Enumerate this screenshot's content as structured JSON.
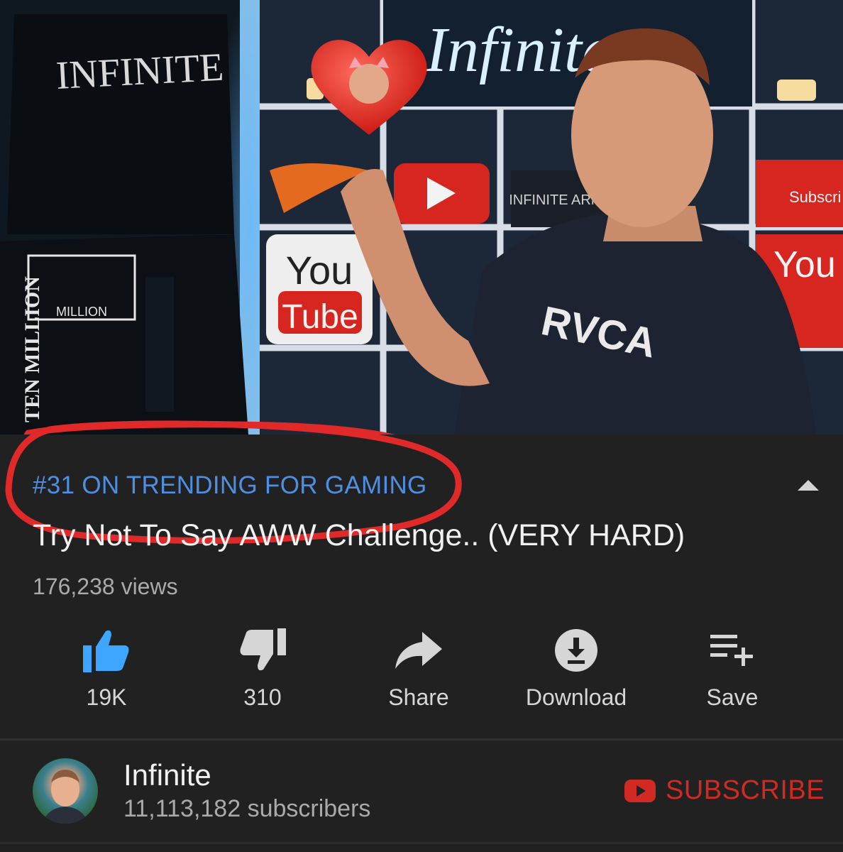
{
  "video": {
    "overlay_texts": {
      "neon_sign": "Infinite",
      "hoodie_print": "INFINITE",
      "jersey_text": "TEN MILLION",
      "jersey_badge": "MILLION",
      "shelf_box": "INFINITE ARMY",
      "pillow_you": "You",
      "pillow_tube": "Tube",
      "right_sign": "Subscri",
      "right_pillow": "You",
      "shirt_brand": "RVCA"
    }
  },
  "trending_label": "#31 ON TRENDING FOR GAMING",
  "title": "Try Not To Say AWW Challenge.. (VERY HARD)",
  "views": "176,238 views",
  "actions": [
    {
      "icon": "thumbs-up-icon",
      "label": "19K",
      "color": "#3ea6ff"
    },
    {
      "icon": "thumbs-down-icon",
      "label": "310",
      "color": "#d6d6d6"
    },
    {
      "icon": "share-icon",
      "label": "Share",
      "color": "#d6d6d6"
    },
    {
      "icon": "download-icon",
      "label": "Download",
      "color": "#d6d6d6"
    },
    {
      "icon": "save-playlist-icon",
      "label": "Save",
      "color": "#d6d6d6"
    }
  ],
  "channel": {
    "name": "Infinite",
    "subscribers": "11,113,182 subscribers"
  },
  "subscribe_label": "SUBSCRIBE",
  "colors": {
    "background": "#212121",
    "trending": "#4f8fe2",
    "subscribe": "#d02a22",
    "annotation": "#e02a2a"
  }
}
